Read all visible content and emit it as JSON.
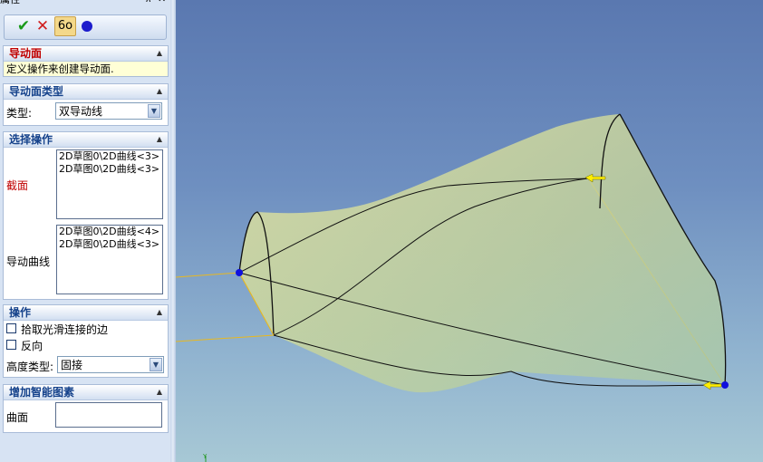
{
  "panel": {
    "title": "属性",
    "pin_glyph": "⊼",
    "close_glyph": "✕",
    "toolbar": {
      "ok": "✔",
      "cancel": "✕",
      "preview": "6o"
    },
    "sections": {
      "guide_surface": {
        "title": "导动面",
        "description": "定义操作来创建导动面."
      },
      "guide_type": {
        "title": "导动面类型",
        "type_label": "类型:",
        "type_value": "双导动线"
      },
      "select_ops": {
        "title": "选择操作",
        "section_label": "截面",
        "section_items": [
          "2D草图0\\2D曲线<3>",
          "2D草图0\\2D曲线<3>"
        ],
        "guide_label": "导动曲线",
        "guide_items": [
          "2D草图0\\2D曲线<4>",
          "2D草图0\\2D曲线<3>"
        ]
      },
      "operations": {
        "title": "操作",
        "check_smooth": "拾取光滑连接的边",
        "check_reverse": "反向",
        "height_label": "高度类型:",
        "height_value": "固接"
      },
      "smart_elements": {
        "title": "增加智能图素",
        "surface_label": "曲面"
      }
    }
  },
  "viewport": {
    "axis_label": "Y",
    "colors": {
      "surface_fill": "#c8d48a",
      "edge": "#111111",
      "guide": "#f0c020",
      "point": "#1010dd",
      "arrow": "#ffee00"
    }
  }
}
